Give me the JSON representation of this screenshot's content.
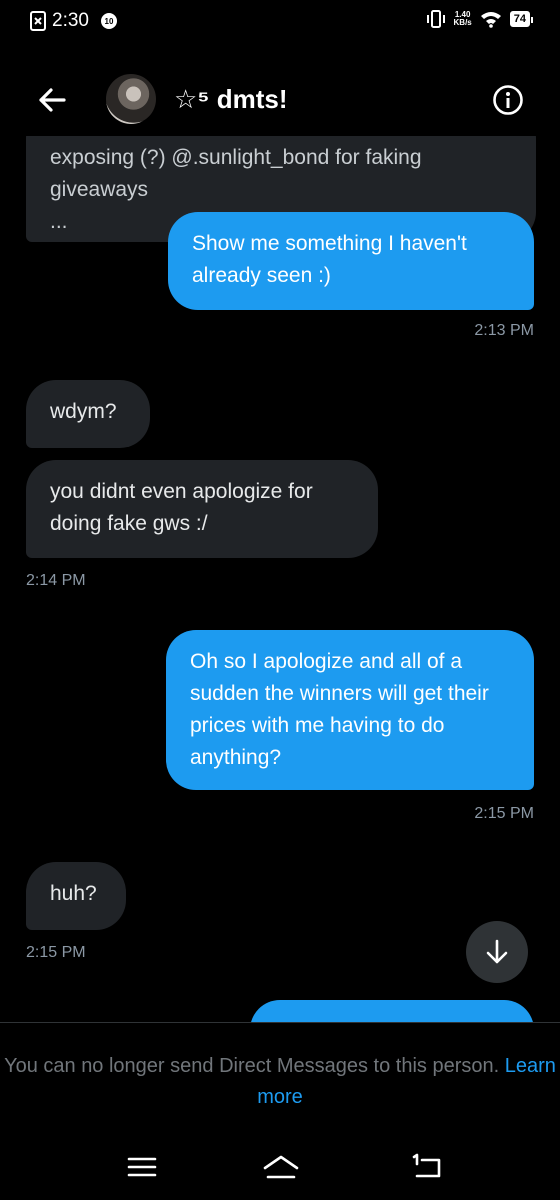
{
  "status_bar": {
    "time": "2:30",
    "notification_badge": "10",
    "net_speed_value": "1.40",
    "net_speed_unit": "KB/s",
    "battery": "74"
  },
  "header": {
    "back_icon": "arrow-left-icon",
    "title": "☆⁵ dmts!",
    "info_icon": "info-icon"
  },
  "messages": [
    {
      "direction": "in",
      "text": "exposing (?) @.sunlight_bond for faking giveaways\n..."
    },
    {
      "direction": "out",
      "text": "Show me something I haven't already seen :)"
    },
    {
      "type": "time",
      "text": "2:13 PM"
    },
    {
      "direction": "in",
      "text": "wdym?"
    },
    {
      "direction": "in",
      "text": "you didnt even apologize for doing fake gws :/"
    },
    {
      "type": "time",
      "text": "2:14 PM"
    },
    {
      "direction": "out",
      "text": "Oh so I apologize and all of a sudden the winners will get their prices with me having to do anything?"
    },
    {
      "type": "time",
      "text": "2:15 PM"
    },
    {
      "direction": "in",
      "text": "huh?"
    },
    {
      "type": "time",
      "text": "2:15 PM"
    }
  ],
  "scroll_down_icon": "arrow-down-icon",
  "footer": {
    "notice": "You can no longer send Direct Messages to this person.",
    "link": "Learn more"
  },
  "colors": {
    "accent": "#1d9bf0",
    "incoming_bubble": "#202327",
    "background": "#000000",
    "muted_text": "#8b98a5"
  }
}
